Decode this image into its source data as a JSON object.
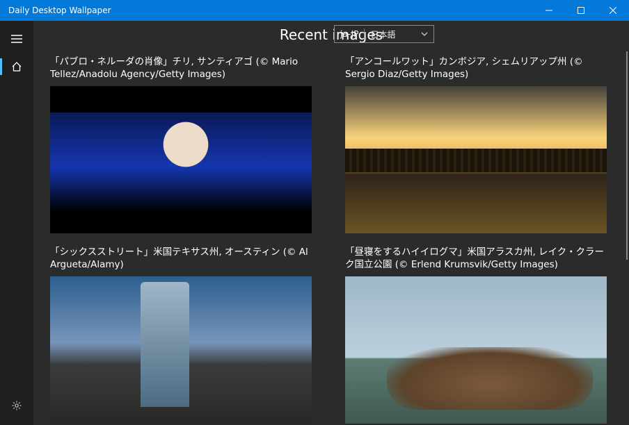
{
  "window": {
    "title": "Daily Desktop Wallpaper"
  },
  "header": {
    "page_title": "Recent images"
  },
  "language_select": {
    "code": "ja-JP",
    "name": "日本語"
  },
  "images": [
    {
      "caption": "「パブロ・ネルーダの肖像」チリ, サンティアゴ (© Mario Tellez/Anadolu Agency/Getty Images)",
      "thumb_class": "img-neruda"
    },
    {
      "caption": "「アンコールワット」カンボジア, シェムリアップ州 (© Sergio Diaz/Getty Images)",
      "thumb_class": "img-angkor"
    },
    {
      "caption": "「シックスストリート」米国テキサス州, オースティン (© Al Argueta/Alamy)",
      "thumb_class": "img-austin"
    },
    {
      "caption": "「昼寝をするハイイログマ」米国アラスカ州, レイク・クラーク国立公園 (© Erlend Krumsvik/Getty Images)",
      "thumb_class": "img-bear"
    }
  ]
}
